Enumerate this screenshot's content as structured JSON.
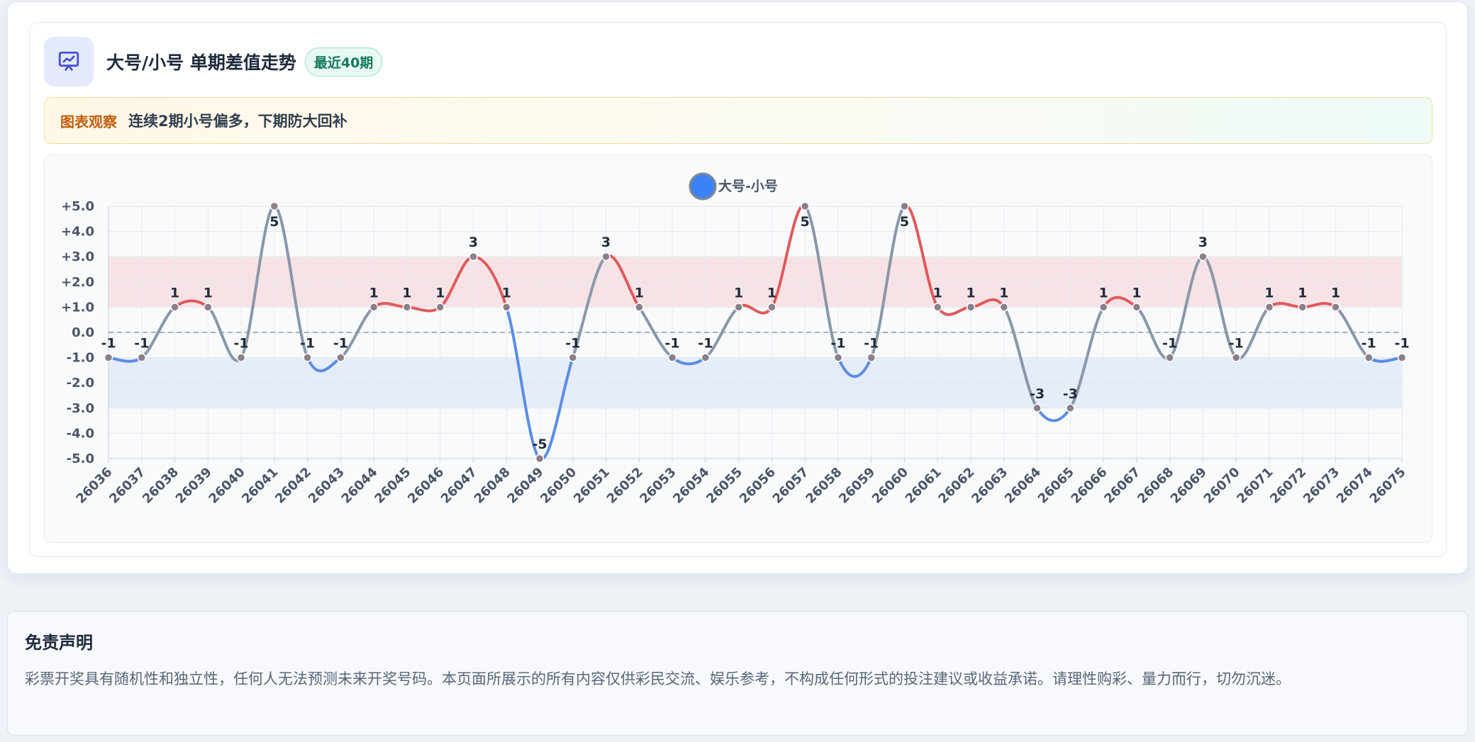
{
  "header": {
    "icon": "presentation-chart-icon",
    "title": "大号/小号 单期差值走势",
    "badge": "最近40期"
  },
  "observation": {
    "tag": "图表观察",
    "text": "连续2期小号偏多，下期防大回补"
  },
  "colors": {
    "positive": "#e05a5a",
    "negative": "#5b8de6",
    "neutral": "#8a97a8",
    "upper_band": "#f7e3e6",
    "lower_band": "#e5ecfa",
    "legend_dot": "#3b82f6"
  },
  "chart_data": {
    "type": "line",
    "legend_position": "top-center",
    "grid": true,
    "ylim": [
      -5,
      5
    ],
    "yticks": [
      "+5.0",
      "+4.0",
      "+3.0",
      "+2.0",
      "+1.0",
      "0.0",
      "-1.0",
      "-2.0",
      "-3.0",
      "-4.0",
      "-5.0"
    ],
    "yticks_values": [
      5,
      4,
      3,
      2,
      1,
      0,
      -1,
      -2,
      -3,
      -4,
      -5
    ],
    "bands": [
      {
        "from": 1,
        "to": 3,
        "tone": "upper"
      },
      {
        "from": -3,
        "to": -1,
        "tone": "lower"
      }
    ],
    "reference_line": 0,
    "categories": [
      "26036",
      "26037",
      "26038",
      "26039",
      "26040",
      "26041",
      "26042",
      "26043",
      "26044",
      "26045",
      "26046",
      "26047",
      "26048",
      "26049",
      "26050",
      "26051",
      "26052",
      "26053",
      "26054",
      "26055",
      "26056",
      "26057",
      "26058",
      "26059",
      "26060",
      "26061",
      "26062",
      "26063",
      "26064",
      "26065",
      "26066",
      "26067",
      "26068",
      "26069",
      "26070",
      "26071",
      "26072",
      "26073",
      "26074",
      "26075"
    ],
    "series": [
      {
        "name": "大号-小号",
        "values": [
          -1,
          -1,
          1,
          1,
          -1,
          5,
          -1,
          -1,
          1,
          1,
          1,
          3,
          1,
          -5,
          -1,
          3,
          1,
          -1,
          -1,
          1,
          1,
          5,
          -1,
          -1,
          5,
          1,
          1,
          1,
          -3,
          -3,
          1,
          1,
          -1,
          3,
          -1,
          1,
          1,
          1,
          -1,
          -1
        ]
      }
    ]
  },
  "disclaimer": {
    "title": "免责声明",
    "text": "彩票开奖具有随机性和独立性，任何人无法预测未来开奖号码。本页面所展示的所有内容仅供彩民交流、娱乐参考，不构成任何形式的投注建议或收益承诺。请理性购彩、量力而行，切勿沉迷。"
  }
}
